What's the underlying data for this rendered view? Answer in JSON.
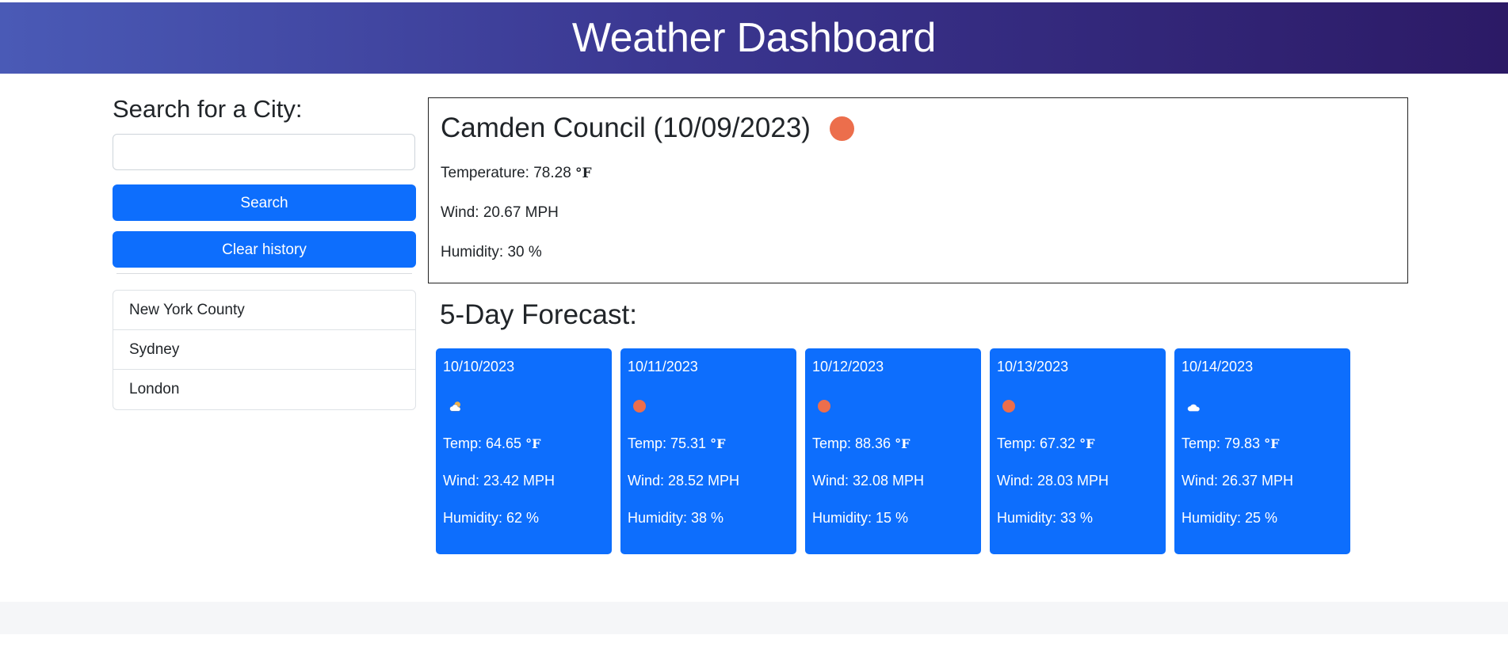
{
  "header": {
    "title": "Weather Dashboard"
  },
  "search": {
    "heading": "Search for a City:",
    "input_value": "",
    "search_label": "Search",
    "clear_label": "Clear history"
  },
  "history": [
    "New York County",
    "Sydney",
    "London"
  ],
  "current": {
    "title": "Camden Council (10/09/2023)",
    "icon": "sun-icon",
    "temperature_label": "Temperature: 78.28",
    "wind": "Wind: 20.67 MPH",
    "humidity": "Humidity: 30 %",
    "unit": "°F"
  },
  "forecast": {
    "heading": "5-Day Forecast:",
    "days": [
      {
        "date": "10/10/2023",
        "icon": "cloud-sun-icon",
        "temp": "Temp: 64.65",
        "wind": "Wind: 23.42 MPH",
        "humidity": "Humidity: 62 %"
      },
      {
        "date": "10/11/2023",
        "icon": "sun-icon",
        "temp": "Temp: 75.31",
        "wind": "Wind: 28.52 MPH",
        "humidity": "Humidity: 38 %"
      },
      {
        "date": "10/12/2023",
        "icon": "sun-icon",
        "temp": "Temp: 88.36",
        "wind": "Wind: 32.08 MPH",
        "humidity": "Humidity: 15 %"
      },
      {
        "date": "10/13/2023",
        "icon": "sun-icon",
        "temp": "Temp: 67.32",
        "wind": "Wind: 28.03 MPH",
        "humidity": "Humidity: 33 %"
      },
      {
        "date": "10/14/2023",
        "icon": "cloud-icon",
        "temp": "Temp: 79.83",
        "wind": "Wind: 26.37 MPH",
        "humidity": "Humidity: 25 %"
      }
    ]
  },
  "colors": {
    "primary": "#0d6efd",
    "sun": "#ec6e4c",
    "header_start": "#4a5ab6",
    "header_end": "#2c1a66"
  }
}
